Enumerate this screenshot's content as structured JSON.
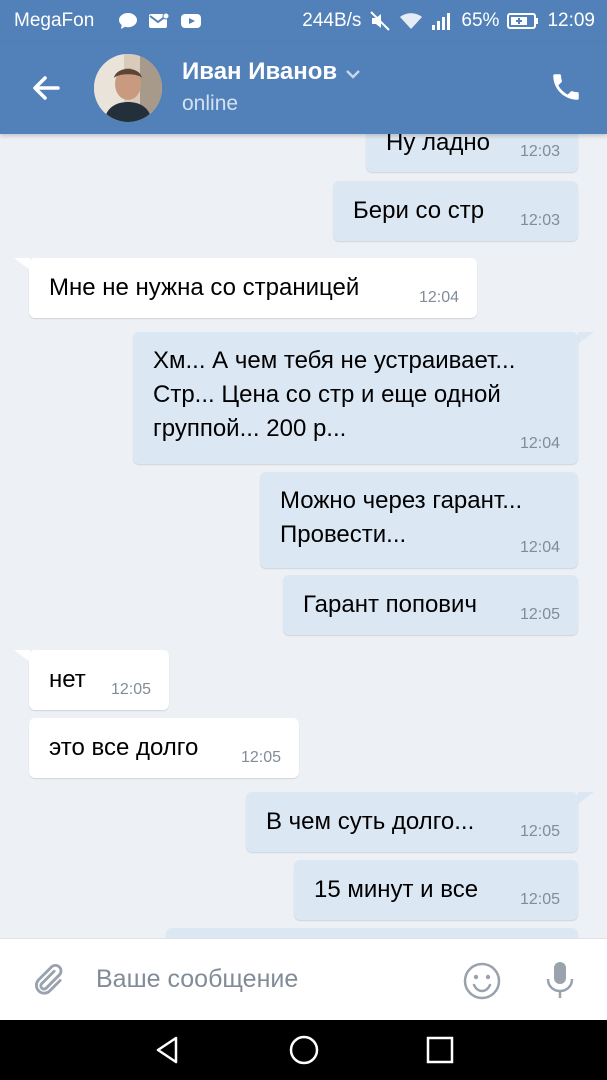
{
  "status_bar": {
    "carrier": "MegaFon",
    "speed": "244B/s",
    "battery": "65%",
    "time": "12:09",
    "icons": [
      "chat-bubble-icon",
      "mail-icon",
      "youtube-icon",
      "mute-icon",
      "wifi-icon",
      "signal-icon",
      "battery-icon"
    ]
  },
  "header": {
    "name": "Иван Иванов",
    "status": "online",
    "icons": [
      "back-arrow-icon",
      "chevron-down-icon",
      "phone-icon"
    ]
  },
  "messages": [
    {
      "dir": "out",
      "text": "Ну ладно",
      "time": "12:03"
    },
    {
      "dir": "out",
      "text": "Бери со стр",
      "time": "12:03"
    },
    {
      "dir": "in",
      "text": "Мне не нужна со страницей",
      "time": "12:04"
    },
    {
      "dir": "out",
      "text": "Хм... А чем тебя не устраивает...\nСтр... Цена со стр и еще одной\nгруппой... 200 р...",
      "time": "12:04"
    },
    {
      "dir": "out",
      "text": "Можно через гарант...\nПровести...",
      "time": "12:04"
    },
    {
      "dir": "out",
      "text": "Гарант попович",
      "time": "12:05"
    },
    {
      "dir": "in",
      "text": "нет",
      "time": "12:05"
    },
    {
      "dir": "in",
      "text": "это все долго",
      "time": "12:05"
    },
    {
      "dir": "out",
      "text": "В чем суть долго...",
      "time": "12:05"
    },
    {
      "dir": "out",
      "text": "15 минут и все",
      "time": "12:05"
    },
    {
      "dir": "out",
      "text": "",
      "time": ""
    }
  ],
  "composer": {
    "placeholder": "Ваше сообщение",
    "icons": [
      "paperclip-icon",
      "emoji-icon",
      "microphone-icon"
    ]
  },
  "nav_bar": {
    "icons": [
      "back-triangle-icon",
      "home-circle-icon",
      "recents-square-icon"
    ]
  },
  "colors": {
    "header": "#5181b8",
    "background": "#edf0f5",
    "outgoing_bubble": "#dce7f4",
    "incoming_bubble": "#ffffff",
    "time_text": "#818c99"
  }
}
